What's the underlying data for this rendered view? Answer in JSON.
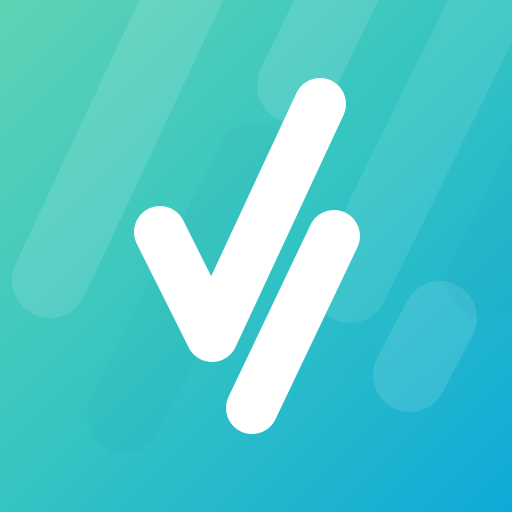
{
  "icon": {
    "name": "checkmark-app-icon",
    "background_gradient": [
      "#5ed3b4",
      "#34c4c2",
      "#0fa9d8"
    ],
    "stripe_light_color": "#ffffff",
    "stripe_dark_color": "#1f8fb0",
    "glyph_color": "#ffffff"
  }
}
